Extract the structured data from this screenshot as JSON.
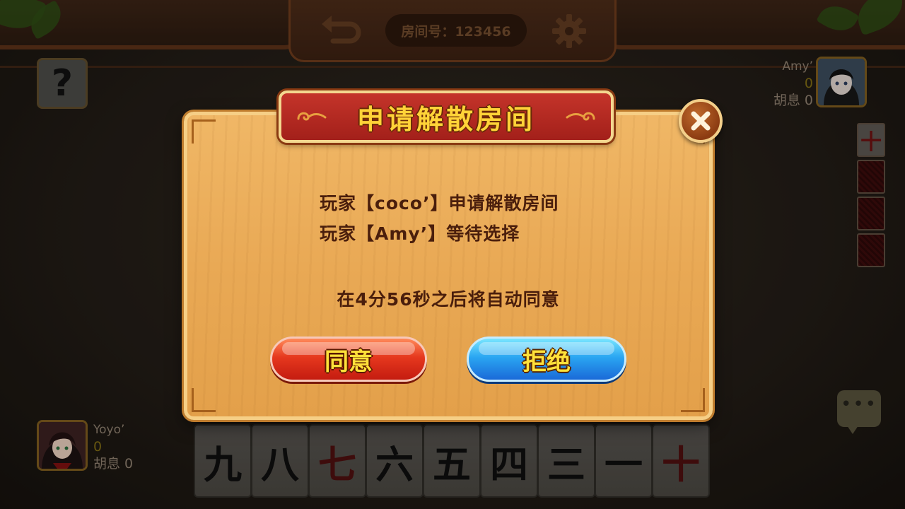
{
  "header": {
    "room_label": "房间号：123456",
    "back_icon": "back-arrow-icon",
    "settings_icon": "gear-icon"
  },
  "help": {
    "label": "?"
  },
  "players": {
    "top_right": {
      "name": "Amy’",
      "score": "0",
      "huxi": "胡息 0"
    },
    "bottom_left": {
      "name": "Yoyo’",
      "score": "0",
      "huxi": "胡息 0"
    }
  },
  "side_cards": {
    "face_up": "十"
  },
  "hand": {
    "tiles": [
      {
        "char": "九",
        "color": "black"
      },
      {
        "char": "八",
        "color": "black"
      },
      {
        "char": "七",
        "color": "red"
      },
      {
        "char": "六",
        "color": "black"
      },
      {
        "char": "五",
        "color": "black"
      },
      {
        "char": "四",
        "color": "black"
      },
      {
        "char": "三",
        "color": "black"
      },
      {
        "char": "一",
        "color": "black"
      },
      {
        "char": "十",
        "color": "red"
      }
    ]
  },
  "dialog": {
    "title": "申请解散房间",
    "line1": "玩家【coco’】申请解散房间",
    "line2": "玩家【Amy’】等待选择",
    "countdown": "在4分56秒之后将自动同意",
    "agree_label": "同意",
    "reject_label": "拒绝",
    "close_icon": "close-icon"
  },
  "colors": {
    "dialog_wood": "#e9a955",
    "title_red": "#b02a20",
    "title_text": "#ffd338",
    "agree_red": "#e6381e",
    "reject_blue": "#2aa6f2",
    "message_text": "#4a1e0c"
  }
}
